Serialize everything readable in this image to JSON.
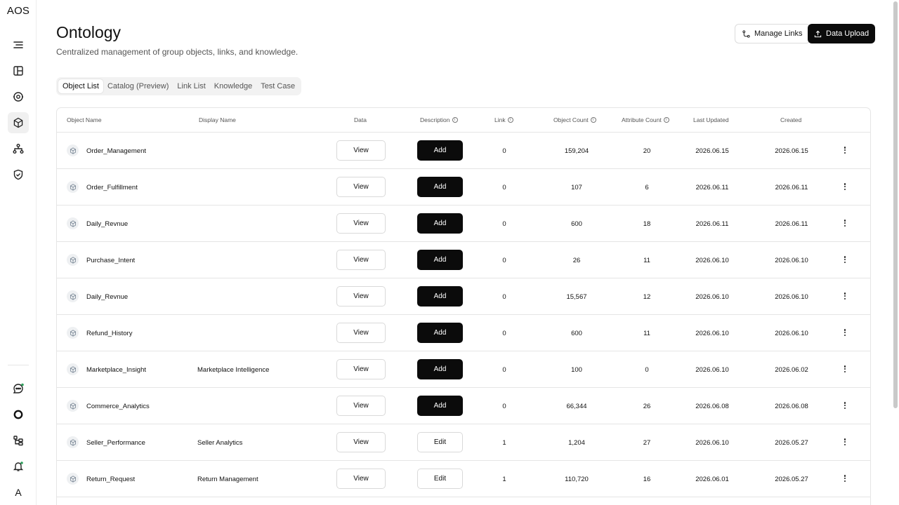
{
  "app": {
    "logo": "AOS"
  },
  "sidebar": {
    "top_icons": [
      "collapse-icon",
      "dashboard-icon",
      "target-icon",
      "ontology-icon",
      "hierarchy-icon",
      "shield-icon"
    ],
    "bottom_icons": [
      "chat-icon",
      "circle-icon",
      "tree-icon",
      "bell-icon"
    ],
    "avatar": "A"
  },
  "header": {
    "title": "Ontology",
    "subtitle": "Centralized management of group objects, links, and knowledge.",
    "manage_links": "Manage Links",
    "data_upload": "Data Upload"
  },
  "tabs": [
    {
      "label": "Object List",
      "active": true
    },
    {
      "label": "Catalog (Preview)",
      "active": false
    },
    {
      "label": "Link List",
      "active": false
    },
    {
      "label": "Knowledge",
      "active": false
    },
    {
      "label": "Test Case",
      "active": false
    }
  ],
  "table": {
    "headers": {
      "object_name": "Object Name",
      "display_name": "Display Name",
      "data": "Data",
      "description": "Description",
      "link": "Link",
      "object_count": "Object Count",
      "attribute_count": "Attribute Count",
      "last_updated": "Last Updated",
      "created": "Created"
    },
    "view_label": "View",
    "rows": [
      {
        "name": "Order_Management",
        "display": "",
        "desc": "Add",
        "link": "0",
        "objects": "159,204",
        "attrs": "20",
        "updated": "2026.06.15",
        "created": "2026.06.15"
      },
      {
        "name": "Order_Fulfillment",
        "display": "",
        "desc": "Add",
        "link": "0",
        "objects": "107",
        "attrs": "6",
        "updated": "2026.06.11",
        "created": "2026.06.11"
      },
      {
        "name": "Daily_Revnue",
        "display": "",
        "desc": "Add",
        "link": "0",
        "objects": "600",
        "attrs": "18",
        "updated": "2026.06.11",
        "created": "2026.06.11"
      },
      {
        "name": "Purchase_Intent",
        "display": "",
        "desc": "Add",
        "link": "0",
        "objects": "26",
        "attrs": "11",
        "updated": "2026.06.10",
        "created": "2026.06.10"
      },
      {
        "name": "Daily_Revnue",
        "display": "",
        "desc": "Add",
        "link": "0",
        "objects": "15,567",
        "attrs": "12",
        "updated": "2026.06.10",
        "created": "2026.06.10"
      },
      {
        "name": "Refund_History",
        "display": "",
        "desc": "Add",
        "link": "0",
        "objects": "600",
        "attrs": "11",
        "updated": "2026.06.10",
        "created": "2026.06.10"
      },
      {
        "name": "Marketplace_Insight",
        "display": "Marketplace Intelligence",
        "desc": "Add",
        "link": "0",
        "objects": "100",
        "attrs": "0",
        "updated": "2026.06.10",
        "created": "2026.06.02"
      },
      {
        "name": "Commerce_Analytics",
        "display": "",
        "desc": "Add",
        "link": "0",
        "objects": "66,344",
        "attrs": "26",
        "updated": "2026.06.08",
        "created": "2026.06.08"
      },
      {
        "name": "Seller_Performance",
        "display": "Seller Analytics",
        "desc": "Edit",
        "link": "1",
        "objects": "1,204",
        "attrs": "27",
        "updated": "2026.06.10",
        "created": "2026.05.27"
      },
      {
        "name": "Return_Request",
        "display": "Return Management",
        "desc": "Edit",
        "link": "1",
        "objects": "110,720",
        "attrs": "16",
        "updated": "2026.06.01",
        "created": "2026.05.27"
      }
    ]
  }
}
